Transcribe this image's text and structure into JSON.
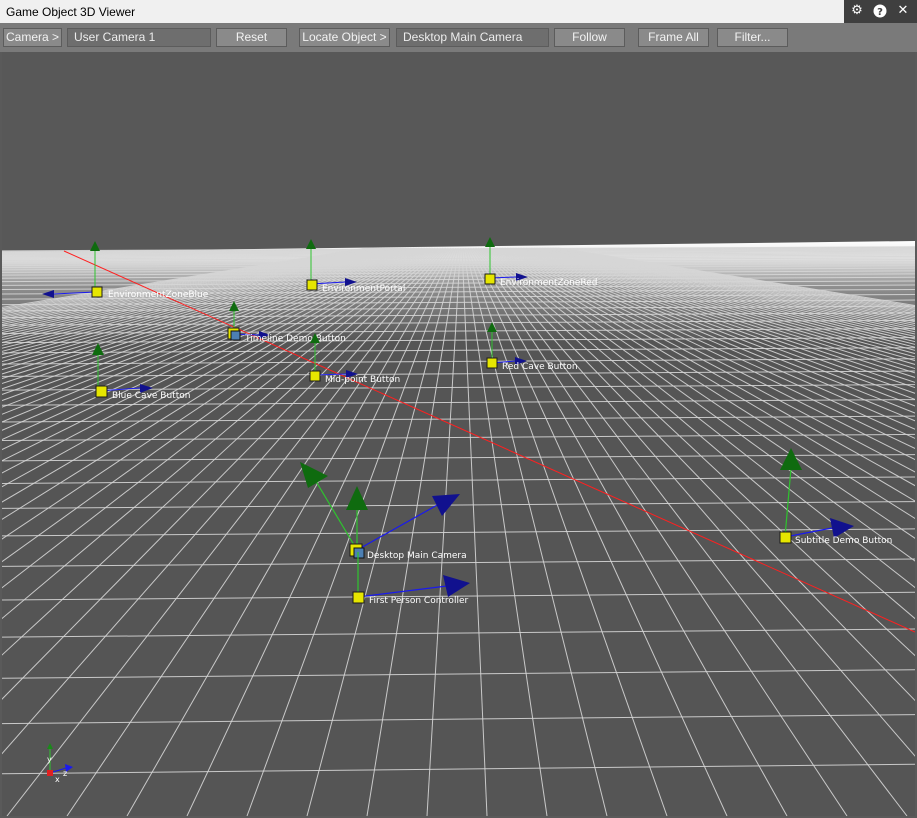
{
  "window": {
    "title": "Game Object 3D Viewer"
  },
  "title_icons": [
    "gear-icon",
    "help-icon",
    "close-icon"
  ],
  "toolbar": {
    "camera_button": "Camera >",
    "camera_value": "User Camera 1",
    "reset_button": "Reset",
    "locate_button": "Locate Object >",
    "locate_value": "Desktop Main Camera",
    "follow_button": "Follow",
    "frame_all_button": "Frame All",
    "filter_button": "Filter..."
  },
  "scene": {
    "objects": [
      "EnvironmentZoneBlue",
      "EnvironmentPortal",
      "EnvironmentZoneRed",
      "Timeline Demo Button",
      "Mid-point Button",
      "Red Cave Button",
      "Blue Cave Button",
      "Desktop Main Camera",
      "First Person Controller",
      "Subtitle Demo Button"
    ],
    "axis_gizmo": {
      "y": "y",
      "x": "x",
      "z": "z"
    }
  },
  "colors": {
    "background": "#555555",
    "grid": "#d6d6d6",
    "axis_red": "#ff2020",
    "y_axis": "#2ec42e",
    "z_axis": "#1a1aee",
    "marker": "#e6e600",
    "label": "#ffffff"
  }
}
